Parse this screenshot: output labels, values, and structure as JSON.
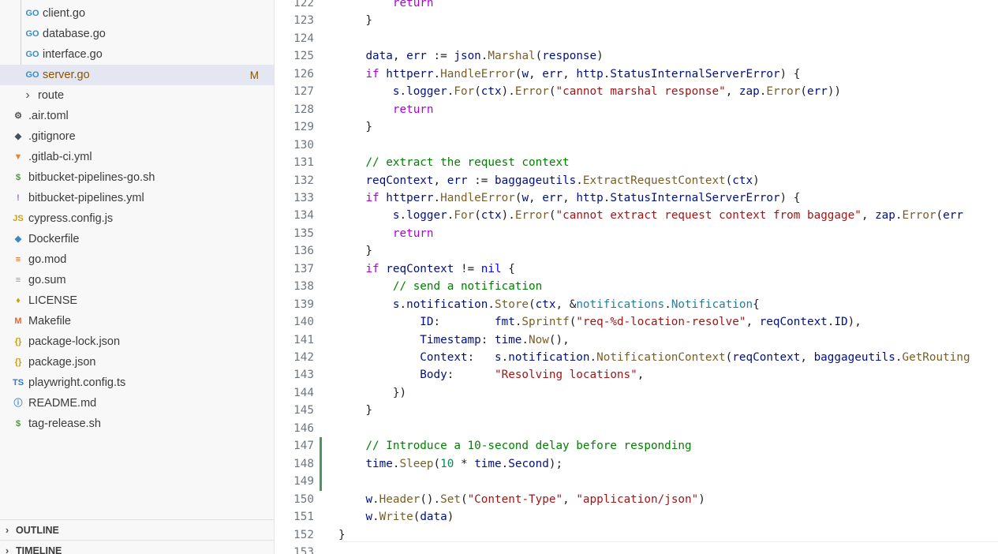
{
  "explorer": {
    "files": [
      {
        "name": "client.go",
        "icon": "go-file-icon",
        "glyph": "GO",
        "color": "#3a8ec8",
        "nested": true
      },
      {
        "name": "database.go",
        "icon": "go-file-icon",
        "glyph": "GO",
        "color": "#3a8ec8",
        "nested": true
      },
      {
        "name": "interface.go",
        "icon": "go-file-icon",
        "glyph": "GO",
        "color": "#3a8ec8",
        "nested": true
      },
      {
        "name": "server.go",
        "icon": "go-file-icon",
        "glyph": "GO",
        "color": "#3a8ec8",
        "nested": true,
        "selected": true,
        "badge": "M"
      },
      {
        "name": "route",
        "icon": "folder-chevron-right-icon",
        "glyph": "›",
        "color": "#555555",
        "folder": true
      },
      {
        "name": ".air.toml",
        "icon": "gear-icon",
        "glyph": "⚙",
        "color": "#555555"
      },
      {
        "name": ".gitignore",
        "icon": "git-diamond-icon",
        "glyph": "◆",
        "color": "#41535b"
      },
      {
        "name": ".gitlab-ci.yml",
        "icon": "gitlab-fox-icon",
        "glyph": "▼",
        "color": "#e2843e"
      },
      {
        "name": "bitbucket-pipelines-go.sh",
        "icon": "dollar-shell-icon",
        "glyph": "$",
        "color": "#4d9a3a"
      },
      {
        "name": "bitbucket-pipelines.yml",
        "icon": "exclamation-yaml-icon",
        "glyph": "!",
        "color": "#a074c4"
      },
      {
        "name": "cypress.config.js",
        "icon": "js-file-icon",
        "glyph": "JS",
        "color": "#c9a20c"
      },
      {
        "name": "Dockerfile",
        "icon": "docker-whale-icon",
        "glyph": "◆",
        "color": "#3b88c3"
      },
      {
        "name": "go.mod",
        "icon": "go-mod-icon",
        "glyph": "≡",
        "color": "#e36a2d"
      },
      {
        "name": "go.sum",
        "icon": "lines-file-icon",
        "glyph": "≡",
        "color": "#999999"
      },
      {
        "name": "LICENSE",
        "icon": "license-ribbon-icon",
        "glyph": "♦",
        "color": "#c9a20c"
      },
      {
        "name": "Makefile",
        "icon": "makefile-m-icon",
        "glyph": "M",
        "color": "#e36a2d"
      },
      {
        "name": "package-lock.json",
        "icon": "json-braces-icon",
        "glyph": "{}",
        "color": "#c9a20c"
      },
      {
        "name": "package.json",
        "icon": "json-braces-icon",
        "glyph": "{}",
        "color": "#c9a20c"
      },
      {
        "name": "playwright.config.ts",
        "icon": "ts-file-icon",
        "glyph": "TS",
        "color": "#3178c6"
      },
      {
        "name": "README.md",
        "icon": "info-circle-icon",
        "glyph": "ⓘ",
        "color": "#3b88c3"
      },
      {
        "name": "tag-release.sh",
        "icon": "dollar-shell-icon",
        "glyph": "$",
        "color": "#4d9a3a"
      }
    ],
    "outline_label": "OUTLINE",
    "timeline_label": "TIMELINE"
  },
  "editor": {
    "colors": {
      "added_line_marker": "#48985d"
    },
    "lines": [
      {
        "n": "122",
        "tokens": [
          [
            "        ",
            "txt"
          ],
          [
            "return",
            "ctl"
          ]
        ]
      },
      {
        "n": "123",
        "tokens": [
          [
            "    }",
            "txt"
          ]
        ]
      },
      {
        "n": "124",
        "tokens": []
      },
      {
        "n": "125",
        "tokens": [
          [
            "    ",
            "txt"
          ],
          [
            "data",
            "var"
          ],
          [
            ", ",
            "txt"
          ],
          [
            "err",
            "var"
          ],
          [
            " := ",
            "txt"
          ],
          [
            "json",
            "var"
          ],
          [
            ".",
            "txt"
          ],
          [
            "Marshal",
            "fn"
          ],
          [
            "(",
            "txt"
          ],
          [
            "response",
            "var"
          ],
          [
            ")",
            "txt"
          ]
        ]
      },
      {
        "n": "126",
        "tokens": [
          [
            "    ",
            "txt"
          ],
          [
            "if",
            "ctl"
          ],
          [
            " ",
            "txt"
          ],
          [
            "httperr",
            "var"
          ],
          [
            ".",
            "txt"
          ],
          [
            "HandleError",
            "fn"
          ],
          [
            "(",
            "txt"
          ],
          [
            "w",
            "var"
          ],
          [
            ", ",
            "txt"
          ],
          [
            "err",
            "var"
          ],
          [
            ", ",
            "txt"
          ],
          [
            "http",
            "var"
          ],
          [
            ".",
            "txt"
          ],
          [
            "StatusInternalServerError",
            "var"
          ],
          [
            ") {",
            "txt"
          ]
        ]
      },
      {
        "n": "127",
        "tokens": [
          [
            "        ",
            "txt"
          ],
          [
            "s",
            "var"
          ],
          [
            ".",
            "txt"
          ],
          [
            "logger",
            "var"
          ],
          [
            ".",
            "txt"
          ],
          [
            "For",
            "fn"
          ],
          [
            "(",
            "txt"
          ],
          [
            "ctx",
            "var"
          ],
          [
            ").",
            "txt"
          ],
          [
            "Error",
            "fn"
          ],
          [
            "(",
            "txt"
          ],
          [
            "\"cannot marshal response\"",
            "str"
          ],
          [
            ", ",
            "txt"
          ],
          [
            "zap",
            "var"
          ],
          [
            ".",
            "txt"
          ],
          [
            "Error",
            "fn"
          ],
          [
            "(",
            "txt"
          ],
          [
            "err",
            "var"
          ],
          [
            "))",
            "txt"
          ]
        ]
      },
      {
        "n": "128",
        "tokens": [
          [
            "        ",
            "txt"
          ],
          [
            "return",
            "ctl"
          ]
        ]
      },
      {
        "n": "129",
        "tokens": [
          [
            "    }",
            "txt"
          ]
        ]
      },
      {
        "n": "130",
        "tokens": []
      },
      {
        "n": "131",
        "tokens": [
          [
            "    ",
            "txt"
          ],
          [
            "// extract the request context",
            "cmt"
          ]
        ]
      },
      {
        "n": "132",
        "tokens": [
          [
            "    ",
            "txt"
          ],
          [
            "reqContext",
            "var"
          ],
          [
            ", ",
            "txt"
          ],
          [
            "err",
            "var"
          ],
          [
            " := ",
            "txt"
          ],
          [
            "baggageutils",
            "var"
          ],
          [
            ".",
            "txt"
          ],
          [
            "ExtractRequestContext",
            "fn"
          ],
          [
            "(",
            "txt"
          ],
          [
            "ctx",
            "var"
          ],
          [
            ")",
            "txt"
          ]
        ]
      },
      {
        "n": "133",
        "tokens": [
          [
            "    ",
            "txt"
          ],
          [
            "if",
            "ctl"
          ],
          [
            " ",
            "txt"
          ],
          [
            "httperr",
            "var"
          ],
          [
            ".",
            "txt"
          ],
          [
            "HandleError",
            "fn"
          ],
          [
            "(",
            "txt"
          ],
          [
            "w",
            "var"
          ],
          [
            ", ",
            "txt"
          ],
          [
            "err",
            "var"
          ],
          [
            ", ",
            "txt"
          ],
          [
            "http",
            "var"
          ],
          [
            ".",
            "txt"
          ],
          [
            "StatusInternalServerError",
            "var"
          ],
          [
            ") {",
            "txt"
          ]
        ]
      },
      {
        "n": "134",
        "tokens": [
          [
            "        ",
            "txt"
          ],
          [
            "s",
            "var"
          ],
          [
            ".",
            "txt"
          ],
          [
            "logger",
            "var"
          ],
          [
            ".",
            "txt"
          ],
          [
            "For",
            "fn"
          ],
          [
            "(",
            "txt"
          ],
          [
            "ctx",
            "var"
          ],
          [
            ").",
            "txt"
          ],
          [
            "Error",
            "fn"
          ],
          [
            "(",
            "txt"
          ],
          [
            "\"cannot extract request context from baggage\"",
            "str"
          ],
          [
            ", ",
            "txt"
          ],
          [
            "zap",
            "var"
          ],
          [
            ".",
            "txt"
          ],
          [
            "Error",
            "fn"
          ],
          [
            "(",
            "txt"
          ],
          [
            "err",
            "var"
          ]
        ]
      },
      {
        "n": "135",
        "tokens": [
          [
            "        ",
            "txt"
          ],
          [
            "return",
            "ctl"
          ]
        ]
      },
      {
        "n": "136",
        "tokens": [
          [
            "    }",
            "txt"
          ]
        ]
      },
      {
        "n": "137",
        "tokens": [
          [
            "    ",
            "txt"
          ],
          [
            "if",
            "ctl"
          ],
          [
            " ",
            "txt"
          ],
          [
            "reqContext",
            "var"
          ],
          [
            " != ",
            "txt"
          ],
          [
            "nil",
            "kw"
          ],
          [
            " {",
            "txt"
          ]
        ]
      },
      {
        "n": "138",
        "tokens": [
          [
            "        ",
            "txt"
          ],
          [
            "// send a notification",
            "cmt"
          ]
        ]
      },
      {
        "n": "139",
        "tokens": [
          [
            "        ",
            "txt"
          ],
          [
            "s",
            "var"
          ],
          [
            ".",
            "txt"
          ],
          [
            "notification",
            "var"
          ],
          [
            ".",
            "txt"
          ],
          [
            "Store",
            "fn"
          ],
          [
            "(",
            "txt"
          ],
          [
            "ctx",
            "var"
          ],
          [
            ", &",
            "txt"
          ],
          [
            "notifications",
            "typ"
          ],
          [
            ".",
            "txt"
          ],
          [
            "Notification",
            "typ"
          ],
          [
            "{",
            "txt"
          ]
        ]
      },
      {
        "n": "140",
        "tokens": [
          [
            "            ",
            "txt"
          ],
          [
            "ID",
            "var"
          ],
          [
            ":        ",
            "txt"
          ],
          [
            "fmt",
            "var"
          ],
          [
            ".",
            "txt"
          ],
          [
            "Sprintf",
            "fn"
          ],
          [
            "(",
            "txt"
          ],
          [
            "\"req-%d-location-resolve\"",
            "str"
          ],
          [
            ", ",
            "txt"
          ],
          [
            "reqContext",
            "var"
          ],
          [
            ".",
            "txt"
          ],
          [
            "ID",
            "var"
          ],
          [
            "),",
            "txt"
          ]
        ]
      },
      {
        "n": "141",
        "tokens": [
          [
            "            ",
            "txt"
          ],
          [
            "Timestamp",
            "var"
          ],
          [
            ": ",
            "txt"
          ],
          [
            "time",
            "var"
          ],
          [
            ".",
            "txt"
          ],
          [
            "Now",
            "fn"
          ],
          [
            "(),",
            "txt"
          ]
        ]
      },
      {
        "n": "142",
        "tokens": [
          [
            "            ",
            "txt"
          ],
          [
            "Context",
            "var"
          ],
          [
            ":   ",
            "txt"
          ],
          [
            "s",
            "var"
          ],
          [
            ".",
            "txt"
          ],
          [
            "notification",
            "var"
          ],
          [
            ".",
            "txt"
          ],
          [
            "NotificationContext",
            "fn"
          ],
          [
            "(",
            "txt"
          ],
          [
            "reqContext",
            "var"
          ],
          [
            ", ",
            "txt"
          ],
          [
            "baggageutils",
            "var"
          ],
          [
            ".",
            "txt"
          ],
          [
            "GetRouting",
            "fn"
          ]
        ]
      },
      {
        "n": "143",
        "tokens": [
          [
            "            ",
            "txt"
          ],
          [
            "Body",
            "var"
          ],
          [
            ":      ",
            "txt"
          ],
          [
            "\"Resolving locations\"",
            "str"
          ],
          [
            ",",
            "txt"
          ]
        ]
      },
      {
        "n": "144",
        "tokens": [
          [
            "        })",
            "txt"
          ]
        ]
      },
      {
        "n": "145",
        "tokens": [
          [
            "    }",
            "txt"
          ]
        ]
      },
      {
        "n": "146",
        "tokens": []
      },
      {
        "n": "147",
        "added": true,
        "tokens": [
          [
            "    ",
            "txt"
          ],
          [
            "// Introduce a 10-second delay before responding",
            "cmt"
          ]
        ]
      },
      {
        "n": "148",
        "added": true,
        "tokens": [
          [
            "    ",
            "txt"
          ],
          [
            "time",
            "var"
          ],
          [
            ".",
            "txt"
          ],
          [
            "Sleep",
            "fn"
          ],
          [
            "(",
            "txt"
          ],
          [
            "10",
            "num"
          ],
          [
            " * ",
            "txt"
          ],
          [
            "time",
            "var"
          ],
          [
            ".",
            "txt"
          ],
          [
            "Second",
            "var"
          ],
          [
            ");",
            "txt"
          ]
        ]
      },
      {
        "n": "149",
        "added": true,
        "tokens": []
      },
      {
        "n": "150",
        "tokens": [
          [
            "    ",
            "txt"
          ],
          [
            "w",
            "var"
          ],
          [
            ".",
            "txt"
          ],
          [
            "Header",
            "fn"
          ],
          [
            "().",
            "txt"
          ],
          [
            "Set",
            "fn"
          ],
          [
            "(",
            "txt"
          ],
          [
            "\"Content-Type\"",
            "str"
          ],
          [
            ", ",
            "txt"
          ],
          [
            "\"application/json\"",
            "str"
          ],
          [
            ")",
            "txt"
          ]
        ]
      },
      {
        "n": "151",
        "tokens": [
          [
            "    ",
            "txt"
          ],
          [
            "w",
            "var"
          ],
          [
            ".",
            "txt"
          ],
          [
            "Write",
            "fn"
          ],
          [
            "(",
            "txt"
          ],
          [
            "data",
            "var"
          ],
          [
            ")",
            "txt"
          ]
        ]
      },
      {
        "n": "152",
        "tokens": [
          [
            "}",
            "txt"
          ]
        ]
      },
      {
        "n": "153",
        "tokens": []
      }
    ]
  }
}
